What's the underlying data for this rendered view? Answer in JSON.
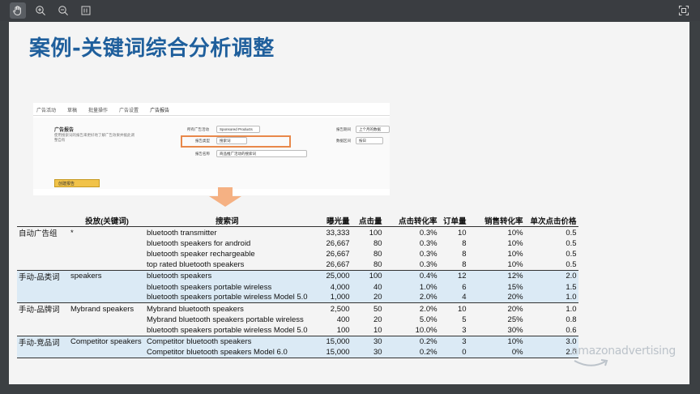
{
  "toolbar": {
    "icons": [
      "hand-icon",
      "zoom-in-icon",
      "zoom-out-icon",
      "page-icon",
      "fit-screen-icon"
    ]
  },
  "slide": {
    "title": "案例-关键词综合分析调整",
    "mini_screenshot": {
      "tabs": [
        "广告活动",
        "草稿",
        "批量操作",
        "广告设置",
        "广告报告"
      ],
      "heading": "广告报告",
      "description": "使用搜索词的报告来更好地了解广告效果并据此调整自有",
      "campaign_type_label": "所有广告活动",
      "campaign_type_value": "Sponsored Products",
      "report_type_label": "报告类型",
      "report_type_value": "搜索词",
      "report_name_label": "报告名称",
      "report_name_value": "商品推广活动的搜索词",
      "period_label": "报告期间",
      "period_value": "上个月的数据",
      "frequency_label": "数据区间",
      "frequency_value": "按日",
      "create_button": "创建报告"
    },
    "table": {
      "headers": {
        "group": "",
        "target": "投放(关键词)",
        "term": "搜索词",
        "impressions": "曝光量",
        "clicks": "点击量",
        "ctr": "点击转化率",
        "orders": "订单量",
        "cvr": "销售转化率",
        "cpc": "单次点击价格"
      },
      "rows": [
        {
          "group": "自动广告组",
          "target": "*",
          "term": "bluetooth transmitter",
          "impressions": "33,333",
          "clicks": "100",
          "ctr": "0.3%",
          "orders": "10",
          "cvr": "10%",
          "cpc": "0.5"
        },
        {
          "group": "",
          "target": "",
          "term": "bluetooth speakers for android",
          "impressions": "26,667",
          "clicks": "80",
          "ctr": "0.3%",
          "orders": "8",
          "cvr": "10%",
          "cpc": "0.5"
        },
        {
          "group": "",
          "target": "",
          "term": "bluetooth speaker rechargeable",
          "impressions": "26,667",
          "clicks": "80",
          "ctr": "0.3%",
          "orders": "8",
          "cvr": "10%",
          "cpc": "0.5"
        },
        {
          "group": "",
          "target": "",
          "term": "top rated bluetooth speakers",
          "impressions": "26,667",
          "clicks": "80",
          "ctr": "0.3%",
          "orders": "8",
          "cvr": "10%",
          "cpc": "0.5"
        },
        {
          "group": "手动-品类词",
          "target": "speakers",
          "term": "bluetooth speakers",
          "impressions": "25,000",
          "clicks": "100",
          "ctr": "0.4%",
          "orders": "12",
          "cvr": "12%",
          "cpc": "2.0"
        },
        {
          "group": "",
          "target": "",
          "term": "bluetooth speakers portable wireless",
          "impressions": "4,000",
          "clicks": "40",
          "ctr": "1.0%",
          "orders": "6",
          "cvr": "15%",
          "cpc": "1.5"
        },
        {
          "group": "",
          "target": "",
          "term": "bluetooth speakers portable wireless Model 5.0",
          "impressions": "1,000",
          "clicks": "20",
          "ctr": "2.0%",
          "orders": "4",
          "cvr": "20%",
          "cpc": "1.0"
        },
        {
          "group": "手动-品牌词",
          "target": "Mybrand speakers",
          "term": "Mybrand bluetooth speakers",
          "impressions": "2,500",
          "clicks": "50",
          "ctr": "2.0%",
          "orders": "10",
          "cvr": "20%",
          "cpc": "1.0"
        },
        {
          "group": "",
          "target": "",
          "term": "Mybrand bluetooth speakers portable wireless",
          "impressions": "400",
          "clicks": "20",
          "ctr": "5.0%",
          "orders": "5",
          "cvr": "25%",
          "cpc": "0.8"
        },
        {
          "group": "",
          "target": "",
          "term": "bluetooth speakers portable wireless Model 5.0",
          "impressions": "100",
          "clicks": "10",
          "ctr": "10.0%",
          "orders": "3",
          "cvr": "30%",
          "cpc": "0.6"
        },
        {
          "group": "手动-竞品词",
          "target": "Competitor speakers",
          "term": "Competitor  bluetooth speakers",
          "impressions": "15,000",
          "clicks": "30",
          "ctr": "0.2%",
          "orders": "3",
          "cvr": "10%",
          "cpc": "3.0"
        },
        {
          "group": "",
          "target": "",
          "term": "Competitor bluetooth speakers Model 6.0",
          "impressions": "15,000",
          "clicks": "30",
          "ctr": "0.2%",
          "orders": "0",
          "cvr": "0%",
          "cpc": "2.0"
        }
      ]
    },
    "watermark": "amazonadvertising"
  },
  "colors": {
    "title": "#1f5f9c",
    "row_highlight": "#dbeaf5",
    "arrow": "#f5b183",
    "highlight_box": "#e8884a"
  }
}
